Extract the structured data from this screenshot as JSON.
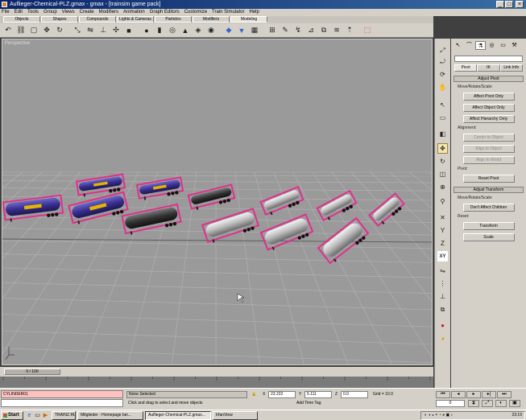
{
  "window": {
    "title": "Auflieger-Chemical-PLZ.gmax - gmax - [trainsim game pack]",
    "minimize": "_",
    "maximize": "□",
    "close": "×"
  },
  "menu": [
    "File",
    "Edit",
    "Tools",
    "Group",
    "Views",
    "Create",
    "Modifiers",
    "Animation",
    "Graph Editors",
    "Customize",
    "Train Simulator",
    "Help"
  ],
  "tabs": [
    {
      "label": "Objects",
      "active": false
    },
    {
      "label": "Shapes",
      "active": false
    },
    {
      "label": "Compounds",
      "active": false
    },
    {
      "label": "Lights & Cameras",
      "active": false
    },
    {
      "label": "Particles",
      "active": false
    },
    {
      "label": "Modifiers",
      "active": false
    },
    {
      "label": "Modeling",
      "active": true
    }
  ],
  "viewport": {
    "label": "Perspective"
  },
  "command_panel": {
    "tabs_icons": [
      "pointer-icon",
      "bend-icon",
      "hierarchy-icon",
      "motion-icon",
      "display-icon",
      "utilities-icon"
    ],
    "mini_buttons": [
      "Pivot",
      "IK",
      "Link Info"
    ],
    "adjust_pivot": {
      "title": "Adjust Pivot",
      "move_rotate_scale": "Move/Rotate/Scale:",
      "buttons": [
        "Affect Pivot Only",
        "Affect Object Only",
        "Affect Hierarchy Only"
      ],
      "alignment_label": "Alignment:",
      "align_buttons": [
        "Center to Object",
        "Align to Object",
        "Align to World"
      ],
      "pivot_label": "Pivot:",
      "reset_pivot": "Reset Pivot"
    },
    "adjust_transform": {
      "title": "Adjust Transform",
      "move_rotate_scale": "Move/Rotate/Scale:",
      "dont_affect": "Don't Affect Children",
      "reset_label": "Reset:",
      "transform": "Transform",
      "scale": "Scale"
    }
  },
  "timeslider": {
    "label": "0 / 100"
  },
  "status": {
    "maxscript_top": "CYLINDER01",
    "maxscript_bottom": "",
    "selection": "None Selected",
    "prompt": "Click and drag to select and move objects",
    "x_label": "X",
    "x_value": "23.222",
    "y_label": "Y",
    "y_value": "5.111",
    "z_label": "Z",
    "z_value": "0.0",
    "grid": "Grid = 10.0",
    "add_time_tag": "Add Time Tag",
    "frame": "0"
  },
  "taskbar": {
    "start": "Start",
    "items": [
      {
        "label": "TRAINZ.RU",
        "active": false
      },
      {
        "label": "Mitglieder - Homepage bei...",
        "active": false
      },
      {
        "label": "Auflieger-Chemical-PLZ.gmax...",
        "active": true
      },
      {
        "label": "IrfanView",
        "active": false
      }
    ],
    "clock": "23:19"
  },
  "colors": {
    "viewport_bg": "#9a9a9a",
    "trailer_frame": "#e0308c",
    "tank_silver": "#c8c8c8",
    "tank_dark": "#3c3c3c"
  }
}
